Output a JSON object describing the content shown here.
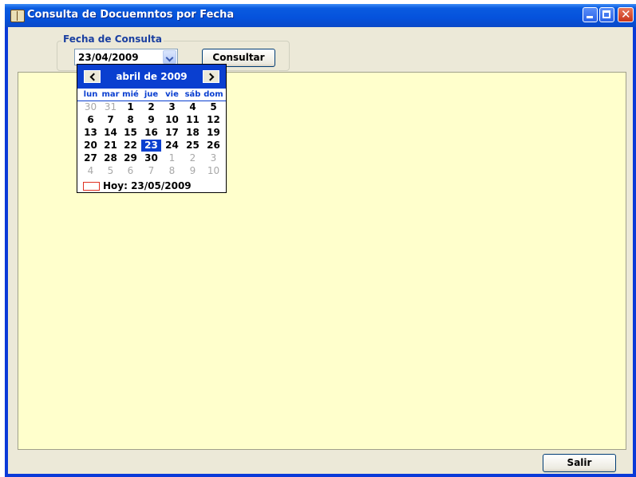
{
  "window": {
    "title": "Consulta de Docuemntos por Fecha",
    "controls": [
      "minimize",
      "maximize",
      "close"
    ]
  },
  "form": {
    "group_label": "Fecha de Consulta",
    "date_value": "23/04/2009",
    "consultar_label": "Consultar",
    "salir_label": "Salir"
  },
  "calendar": {
    "month_title": "abril de 2009",
    "day_headers": [
      "lun",
      "mar",
      "mié",
      "jue",
      "vie",
      "sáb",
      "dom"
    ],
    "weeks": [
      [
        "30",
        "31",
        "1",
        "2",
        "3",
        "4",
        "5"
      ],
      [
        "6",
        "7",
        "8",
        "9",
        "10",
        "11",
        "12"
      ],
      [
        "13",
        "14",
        "15",
        "16",
        "17",
        "18",
        "19"
      ],
      [
        "20",
        "21",
        "22",
        "23",
        "24",
        "25",
        "26"
      ],
      [
        "27",
        "28",
        "29",
        "30",
        "1",
        "2",
        "3"
      ],
      [
        "4",
        "5",
        "6",
        "7",
        "8",
        "9",
        "10"
      ]
    ],
    "other_month_cells": [
      [
        0,
        0
      ],
      [
        0,
        1
      ],
      [
        4,
        4
      ],
      [
        4,
        5
      ],
      [
        4,
        6
      ],
      [
        5,
        0
      ],
      [
        5,
        1
      ],
      [
        5,
        2
      ],
      [
        5,
        3
      ],
      [
        5,
        4
      ],
      [
        5,
        5
      ],
      [
        5,
        6
      ]
    ],
    "selected_cell": [
      3,
      3
    ],
    "today_label": "Hoy: 23/05/2009"
  },
  "colors": {
    "titlebar": "#0552dc",
    "window_bg": "#ece9d8",
    "panel_bg": "#ffffcc",
    "calendar_header": "#0a3fd0",
    "today_marker": "#e03020"
  },
  "icons": {
    "app": "book-icon",
    "dropdown": "chevron-down-icon",
    "prev": "chevron-left-icon",
    "next": "chevron-right-icon"
  }
}
